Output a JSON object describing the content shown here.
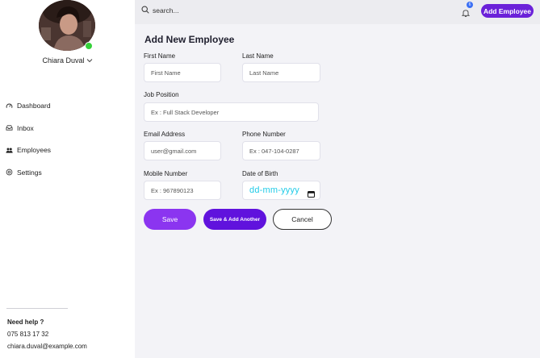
{
  "user": {
    "name": "Chiara Duval",
    "status_color": "#35d13a"
  },
  "sidebar": {
    "items": [
      {
        "label": "Dashboard",
        "icon": "gauge-icon"
      },
      {
        "label": "Inbox",
        "icon": "inbox-icon"
      },
      {
        "label": "Employees",
        "icon": "people-icon"
      },
      {
        "label": "Settings",
        "icon": "gear-icon"
      }
    ],
    "help_title": "Need help ?",
    "help_phone": "075 813 17 32",
    "help_email": "chiara.duval@example.com"
  },
  "topbar": {
    "search_placeholder": "search...",
    "notification_count": "6",
    "add_button": "Add Employee",
    "accent": "#6b21d9"
  },
  "form": {
    "title": "Add New Employee",
    "first_name_label": "First Name",
    "first_name_placeholder": "First Name",
    "last_name_label": "Last Name",
    "last_name_placeholder": "Last Name",
    "job_label": "Job Position",
    "job_placeholder": "Ex : Full Stack Developer",
    "email_label": "Email Address",
    "email_placeholder": "user@gmail.com",
    "phone_label": "Phone Number",
    "phone_placeholder": "Ex : 047-104-0287",
    "mobile_label": "Mobile Number",
    "mobile_placeholder": "Ex : 967890123",
    "dob_label": "Date of Birth",
    "dob_placeholder": "dd-mm-yyyy",
    "save": "Save",
    "save_add": "Save & Add Another",
    "cancel": "Cancel"
  }
}
